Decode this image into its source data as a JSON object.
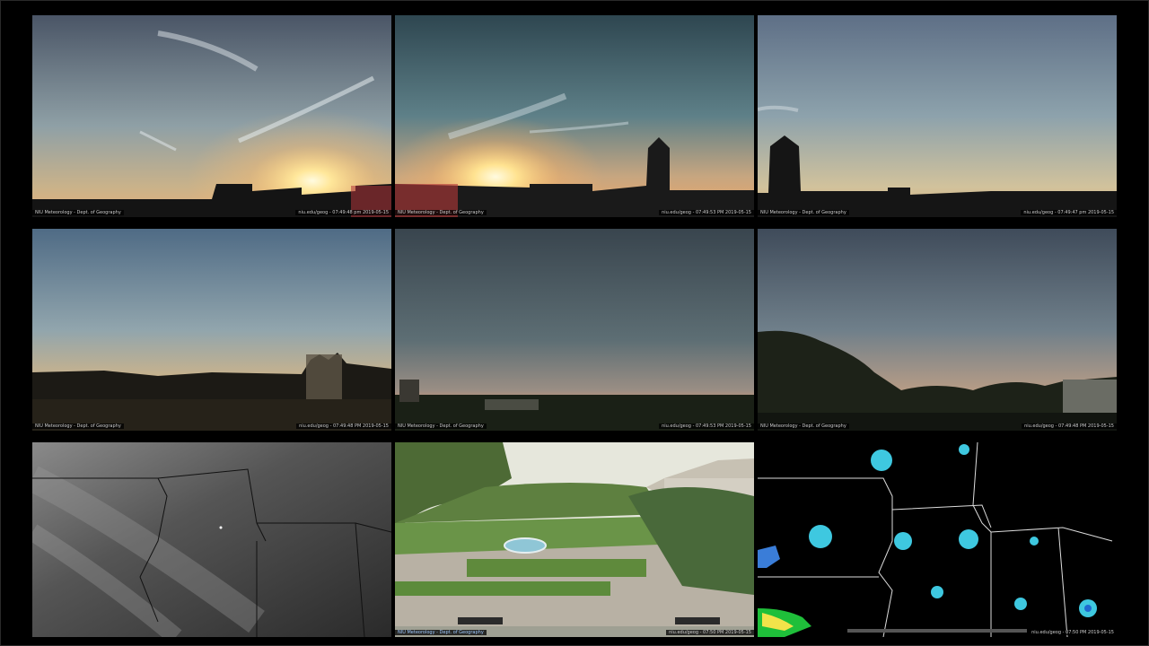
{
  "cams": [
    {
      "left_caption": "NIU Meteorology - Dept. of Geography",
      "right_caption": "niu.edu/geog - 07:49:48 pm 2019-05-15"
    },
    {
      "left_caption": "NIU Meteorology - Dept. of Geography",
      "right_caption": "niu.edu/geog - 07:49:53 PM 2019-05-15"
    },
    {
      "left_caption": "NIU Meteorology - Dept. of Geography",
      "right_caption": "niu.edu/geog - 07:49:47 pm 2019-05-15"
    },
    {
      "left_caption": "NIU Meteorology - Dept. of Geography",
      "right_caption": "niu.edu/geog - 07:49:48 PM 2019-05-15"
    },
    {
      "left_caption": "NIU Meteorology - Dept. of Geography",
      "right_caption": "niu.edu/geog - 07:49:53 PM 2019-05-15"
    },
    {
      "left_caption": "NIU Meteorology - Dept. of Geography",
      "right_caption": "niu.edu/geog - 07:49:48 PM 2019-05-15"
    },
    {
      "left_caption": "",
      "right_caption": ""
    },
    {
      "left_caption": "NIU Meteorology - Dept. of Geography",
      "right_caption": "niu.edu/geog - 07:50 PM 2019-05-15"
    },
    {
      "left_caption": "",
      "right_caption": "niu.edu/geog - 07:50 PM 2019-05-15"
    }
  ]
}
